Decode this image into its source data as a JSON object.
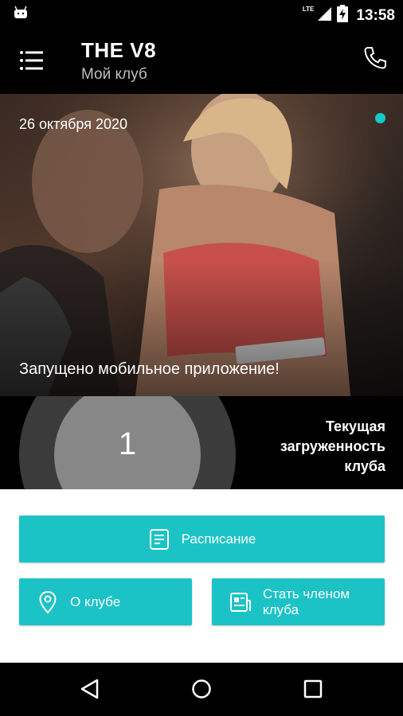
{
  "status_bar": {
    "time": "13:58",
    "network": "LTE",
    "icons": [
      "android-icon",
      "lte-signal-icon",
      "battery-charging-icon"
    ]
  },
  "app_bar": {
    "title": "THE V8",
    "subtitle": "Мой клуб",
    "icons": [
      "menu-icon",
      "phone-icon"
    ]
  },
  "news": {
    "date": "26 октября 2020",
    "caption": "Запущено мобильное приложение!"
  },
  "occupancy": {
    "value": "1",
    "label": "Текущая загруженность клуба"
  },
  "actions": {
    "schedule_label": "Расписание",
    "about_label": "О клубе",
    "member_label": "Стать членом клуба"
  },
  "nav_bar": {
    "icons": [
      "back-icon",
      "home-icon",
      "recents-icon"
    ]
  },
  "colors": {
    "accent": "#1cc3c6",
    "indicator": "#16c9cc",
    "background": "#000000",
    "panel": "#ffffff"
  }
}
